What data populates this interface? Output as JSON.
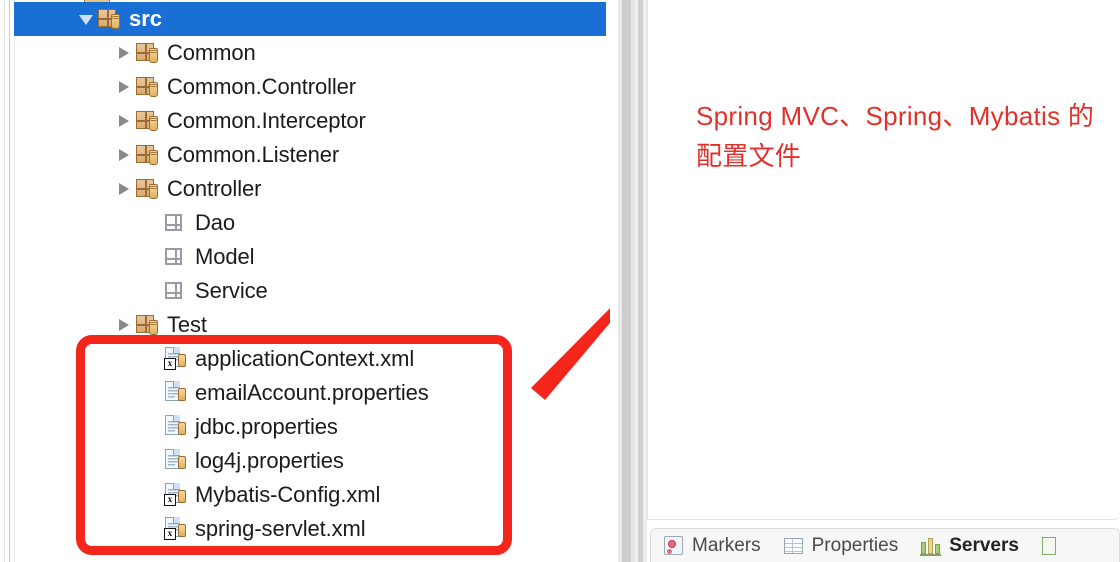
{
  "explorer": {
    "tree": [
      {
        "label": "src",
        "icon": "package-icon",
        "twisty": "open",
        "indent": 62,
        "selected": true,
        "type": "pkg"
      },
      {
        "label": "Common",
        "icon": "package-icon",
        "twisty": "closed",
        "indent": 100,
        "selected": false,
        "type": "pkg"
      },
      {
        "label": "Common.Controller",
        "icon": "package-icon",
        "twisty": "closed",
        "indent": 100,
        "selected": false,
        "type": "pkg"
      },
      {
        "label": "Common.Interceptor",
        "icon": "package-icon",
        "twisty": "closed",
        "indent": 100,
        "selected": false,
        "type": "pkg"
      },
      {
        "label": "Common.Listener",
        "icon": "package-icon",
        "twisty": "closed",
        "indent": 100,
        "selected": false,
        "type": "pkg"
      },
      {
        "label": "Controller",
        "icon": "package-icon",
        "twisty": "closed",
        "indent": 100,
        "selected": false,
        "type": "pkg"
      },
      {
        "label": "Dao",
        "icon": "empty-package-icon",
        "twisty": "none",
        "indent": 128,
        "selected": false,
        "type": "pkgempty"
      },
      {
        "label": "Model",
        "icon": "empty-package-icon",
        "twisty": "none",
        "indent": 128,
        "selected": false,
        "type": "pkgempty"
      },
      {
        "label": "Service",
        "icon": "empty-package-icon",
        "twisty": "none",
        "indent": 128,
        "selected": false,
        "type": "pkgempty"
      },
      {
        "label": "Test",
        "icon": "package-icon",
        "twisty": "closed",
        "indent": 100,
        "selected": false,
        "type": "pkg"
      },
      {
        "label": "applicationContext.xml",
        "icon": "xml-file-icon",
        "twisty": "none",
        "indent": 128,
        "selected": false,
        "type": "filexml"
      },
      {
        "label": "emailAccount.properties",
        "icon": "properties-file-icon",
        "twisty": "none",
        "indent": 128,
        "selected": false,
        "type": "file"
      },
      {
        "label": "jdbc.properties",
        "icon": "properties-file-icon",
        "twisty": "none",
        "indent": 128,
        "selected": false,
        "type": "file"
      },
      {
        "label": "log4j.properties",
        "icon": "properties-file-icon",
        "twisty": "none",
        "indent": 128,
        "selected": false,
        "type": "file"
      },
      {
        "label": "Mybatis-Config.xml",
        "icon": "xml-file-icon",
        "twisty": "none",
        "indent": 128,
        "selected": false,
        "type": "filexml"
      },
      {
        "label": "spring-servlet.xml",
        "icon": "xml-file-icon",
        "twisty": "none",
        "indent": 128,
        "selected": false,
        "type": "filexml"
      }
    ],
    "xml_badge_letter": "x"
  },
  "annotation": {
    "text": "Spring MVC、Spring、Mybatis 的配置文件",
    "color": "#e2302a"
  },
  "highlight": {
    "box_color": "#f4251b",
    "arrow_color": "#f4251b"
  },
  "view_tabs": [
    {
      "label": "Markers",
      "icon": "markers-icon",
      "active": false
    },
    {
      "label": "Properties",
      "icon": "properties-table-icon",
      "active": false
    },
    {
      "label": "Servers",
      "icon": "servers-icon",
      "active": true
    }
  ]
}
